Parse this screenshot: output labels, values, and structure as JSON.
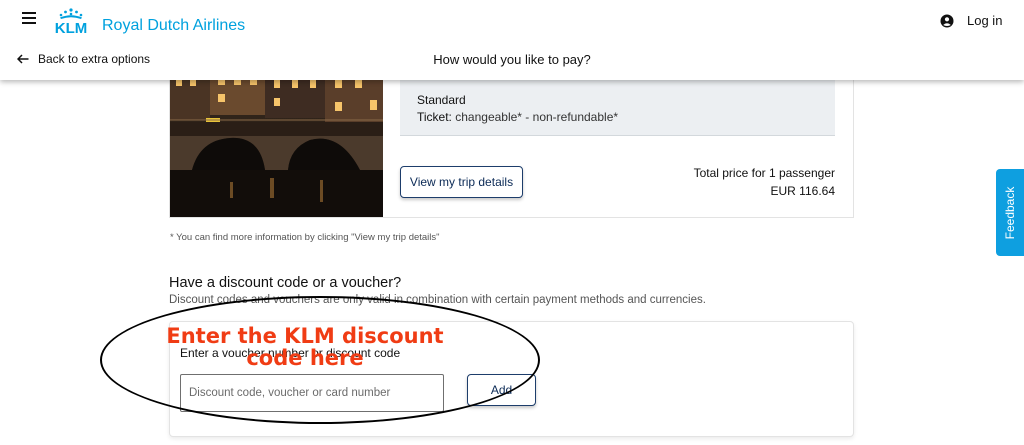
{
  "header": {
    "brand_logo_text": "KLM",
    "brand_name": "Royal Dutch Airlines",
    "login_label": "Log in",
    "back_label": "Back to extra options",
    "page_title": "How would you like to pay?"
  },
  "trip": {
    "fare_name": "Standard",
    "ticket_label": "Ticket:",
    "ticket_value": "changeable* - non-refundable*",
    "details_button": "View my trip details",
    "total_label": "Total price for 1 passenger",
    "total_value": "EUR 116.64",
    "footnote": "* You can find more information by clicking \"View my trip details\""
  },
  "discount": {
    "title": "Have a discount code or a voucher?",
    "subtitle": "Discount codes and vouchers are only valid in combination with certain payment methods and currencies.",
    "input_label": "Enter a voucher number or discount code",
    "input_placeholder": "Discount code, voucher or card number",
    "input_value": "",
    "add_button": "Add"
  },
  "annotation": {
    "text": "Enter the KLM discount code here"
  },
  "feedback": {
    "label": "Feedback"
  },
  "colors": {
    "brand_blue": "#00a1de",
    "feedback_blue": "#0e9fe0",
    "annotation_red": "#f03c14",
    "button_navy": "#0b2a56"
  },
  "icons": [
    "menu-icon",
    "klm-crown-logo",
    "account-icon",
    "arrow-left-icon"
  ]
}
